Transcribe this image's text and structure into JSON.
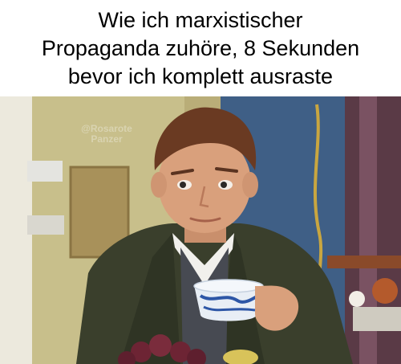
{
  "meme": {
    "caption_lines": [
      "Wie ich marxistischer",
      "Propaganda zuhöre, 8 Sekunden",
      "bevor ich komplett ausraste"
    ],
    "watermark": {
      "handle": "@Rosarote",
      "name": "Panzer"
    }
  },
  "colors": {
    "wall_left": "#c9c08a",
    "wall_blue": "#3f5f86",
    "robe": "#3a3f2c",
    "skin": "#d9a07c",
    "hair": "#6a3a22",
    "cup": "#e8eef5",
    "cup_pattern": "#2d56a6"
  }
}
